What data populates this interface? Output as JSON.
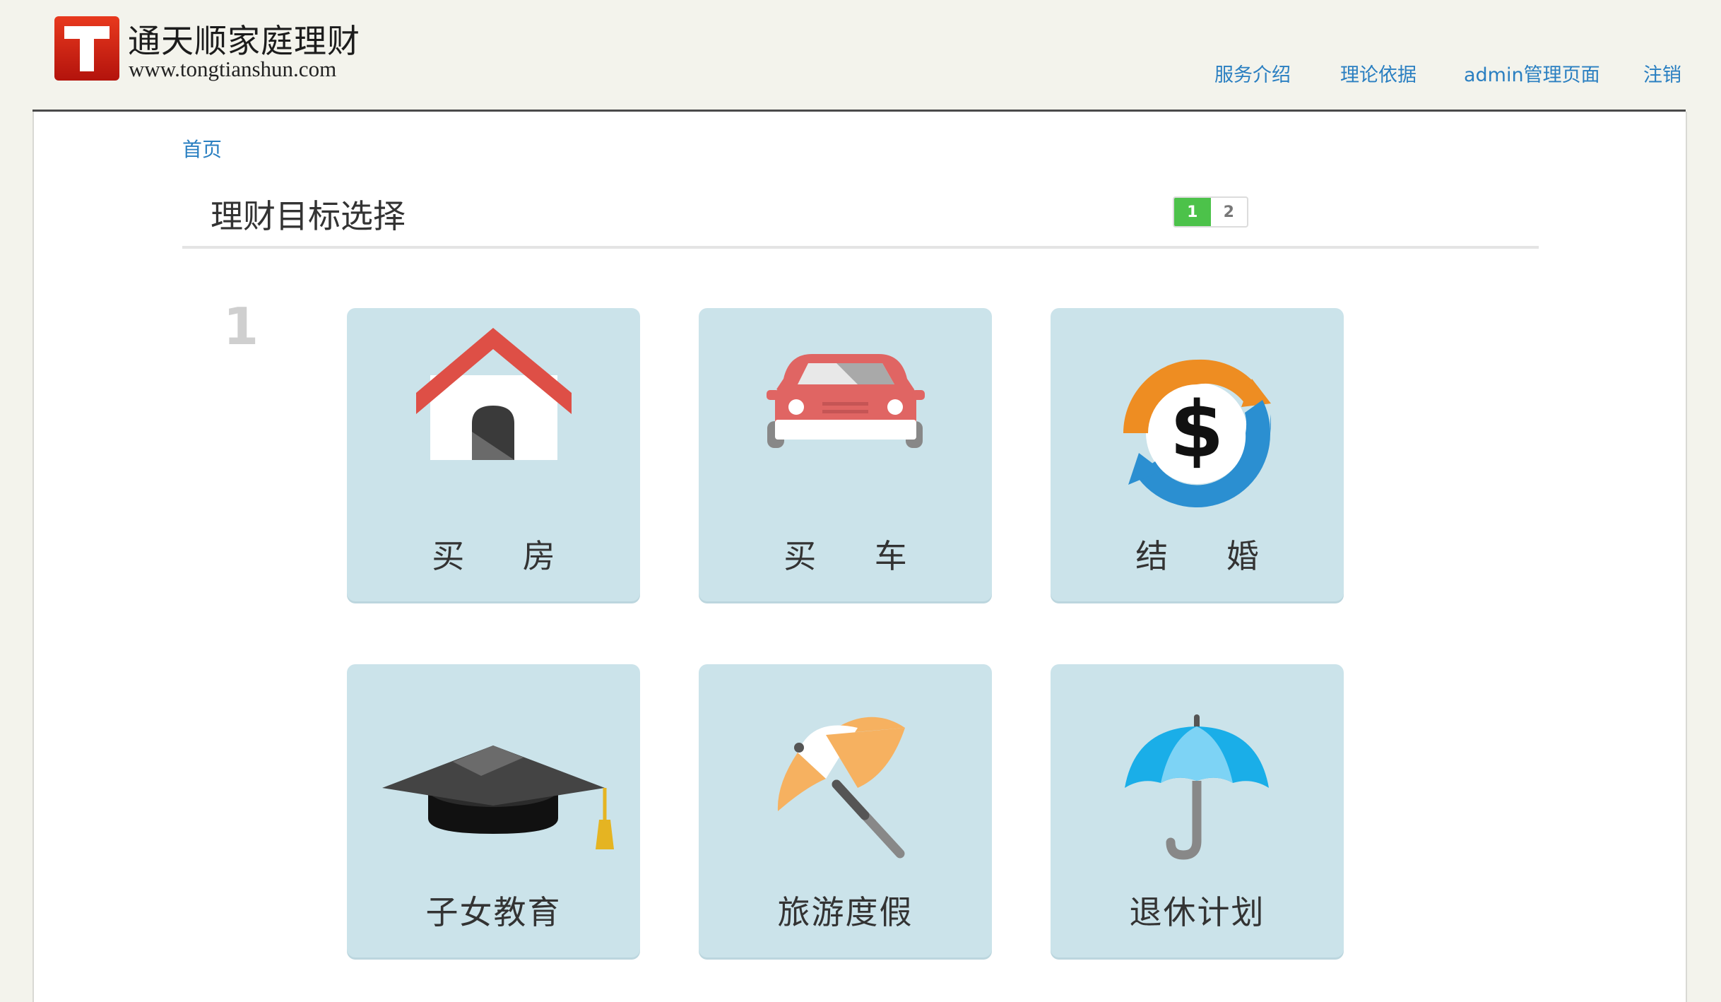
{
  "brand": {
    "name": "通天顺家庭理财",
    "url": "www.tongtianshun.com",
    "logo_letter": "T",
    "logo_color": "#d42a12"
  },
  "nav": {
    "services": "服务介绍",
    "theory": "理论依据",
    "admin": "admin管理页面",
    "logout": "注销"
  },
  "breadcrumb": {
    "home": "首页"
  },
  "section": {
    "title": "理财目标选择"
  },
  "steps": {
    "current": "1",
    "next": "2"
  },
  "group": {
    "number": "1"
  },
  "goals": {
    "house": {
      "label": "买 房",
      "icon": "house-icon"
    },
    "car": {
      "label": "买 车",
      "icon": "car-icon"
    },
    "wedding": {
      "label": "结 婚",
      "icon": "dollar-exchange-icon"
    },
    "education": {
      "label": "子女教育",
      "icon": "graduation-cap-icon"
    },
    "vacation": {
      "label": "旅游度假",
      "icon": "beach-umbrella-icon"
    },
    "retirement": {
      "label": "退休计划",
      "icon": "umbrella-icon"
    }
  },
  "colors": {
    "link": "#2a7fc1",
    "card_bg": "#cbe3ea",
    "step_active": "#4cc24a",
    "header_bg": "#f3f3ec"
  }
}
